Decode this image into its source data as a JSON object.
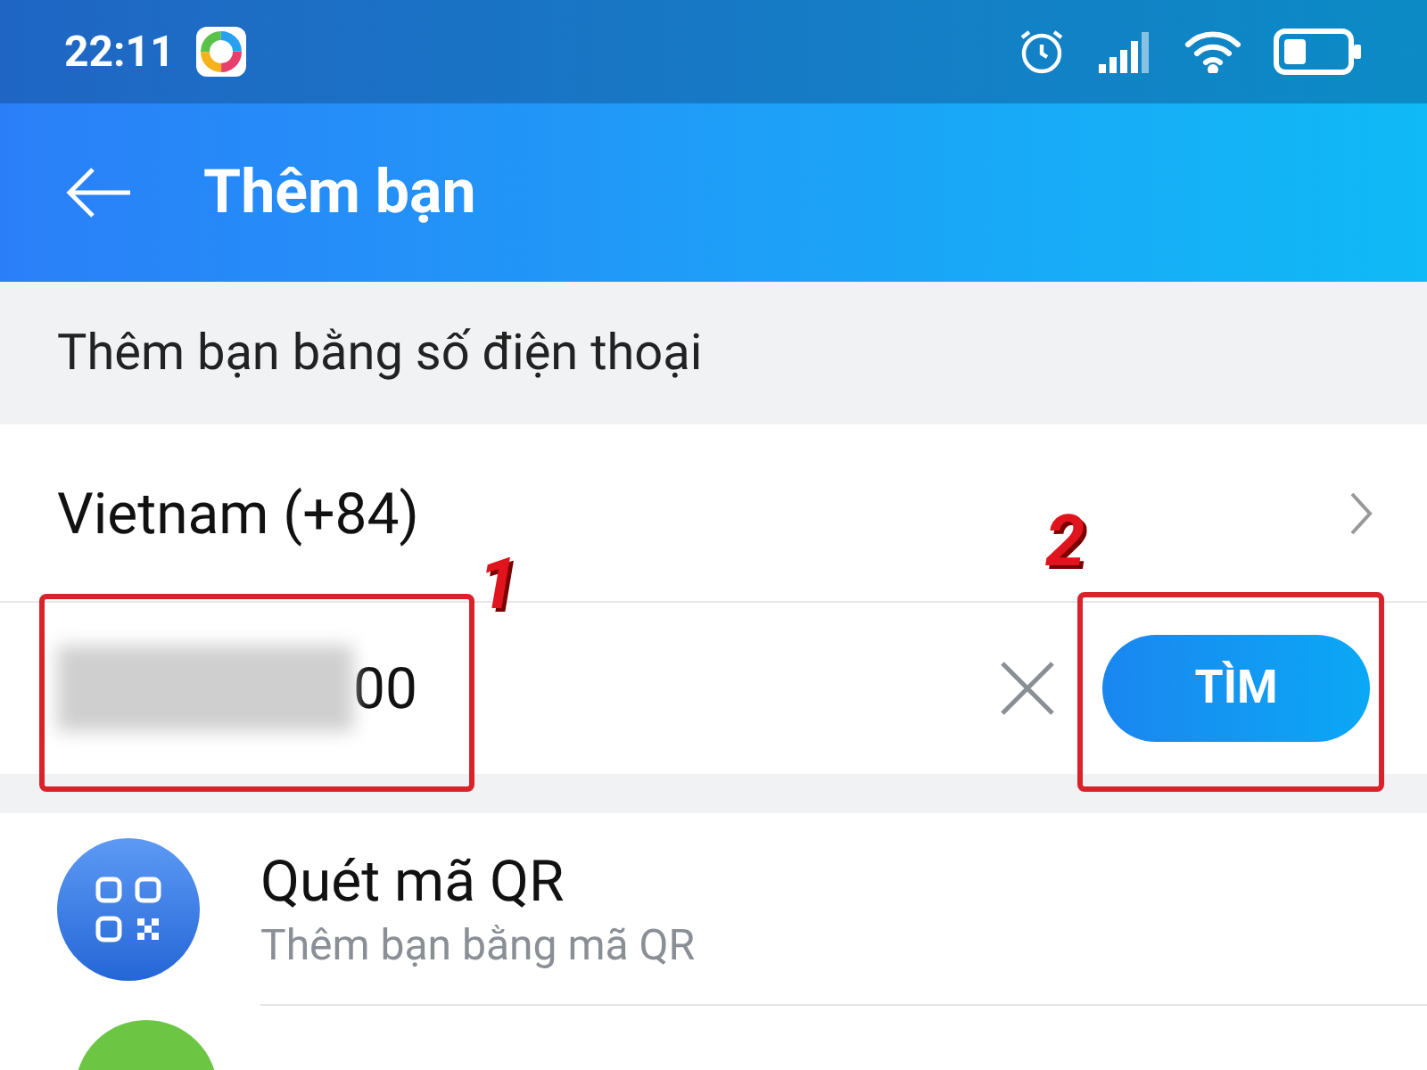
{
  "status_bar": {
    "time": "22:11"
  },
  "header": {
    "title": "Thêm bạn"
  },
  "section": {
    "title": "Thêm bạn bằng số điện thoại"
  },
  "country": {
    "label": "Vietnam (+84)"
  },
  "phone_field": {
    "value": "00",
    "search_button": "TÌM"
  },
  "options": [
    {
      "kind": "qr",
      "title": "Quét mã QR",
      "subtitle": "Thêm bạn bằng mã QR"
    },
    {
      "kind": "partial"
    }
  ],
  "annotations": [
    {
      "label": "1"
    },
    {
      "label": "2"
    }
  ]
}
